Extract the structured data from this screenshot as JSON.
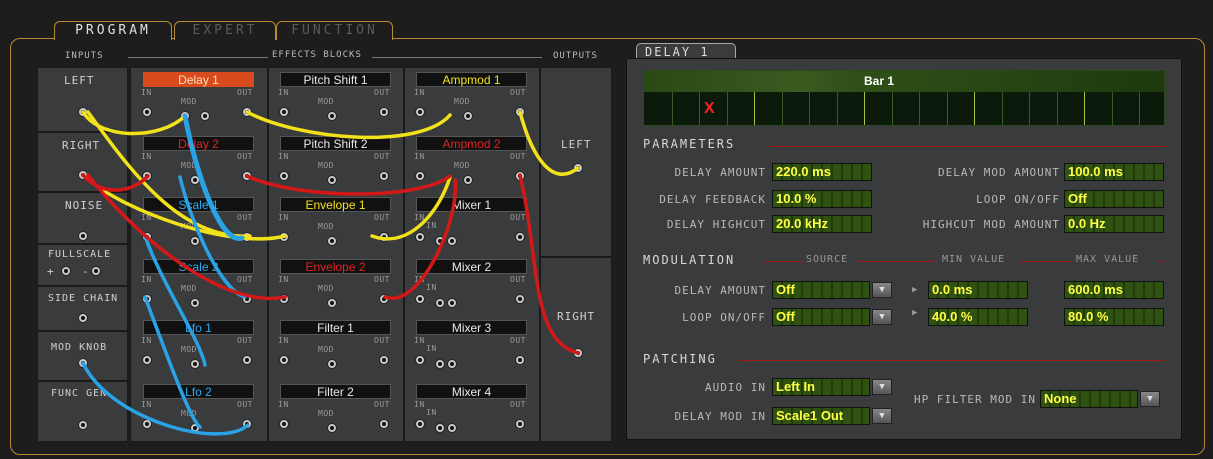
{
  "tabs": {
    "program": "PROGRAM",
    "expert": "EXPERT",
    "function": "FUNCTION"
  },
  "headers": {
    "inputs": "INPUTS",
    "effects": "EFFECTS BLOCKS",
    "outputs": "OUTPUTS"
  },
  "inputs": {
    "left": "LEFT",
    "right": "RIGHT",
    "noise": "NOISE",
    "fullscale": "FULLSCALE",
    "plus": "+",
    "minus": "-",
    "side_chain": "SIDE CHAIN",
    "mod_knob": "MOD KNOB",
    "func_gen": "FUNC GEN"
  },
  "outputs": {
    "left": "LEFT",
    "right": "RIGHT"
  },
  "jack_labels": {
    "in": "IN",
    "out": "OUT",
    "mod": "MOD"
  },
  "blocks": {
    "delay1": "Delay 1",
    "delay2": "Delay 2",
    "scale1": "Scale 1",
    "scale2": "Scale 2",
    "lfo1": "Lfo 1",
    "lfo2": "Lfo 2",
    "pitch1": "Pitch Shift 1",
    "pitch2": "Pitch Shift 2",
    "env1": "Envelope 1",
    "env2": "Envelope 2",
    "filter1": "Filter 1",
    "filter2": "Filter 2",
    "amp1": "Ampmod 1",
    "amp2": "Ampmod 2",
    "mixer1": "Mixer 1",
    "mixer2": "Mixer 2",
    "mixer3": "Mixer 3",
    "mixer4": "Mixer 4"
  },
  "right_panel": {
    "tab": "DELAY 1",
    "bar_label": "Bar 1",
    "marker": "X",
    "parameters": "PARAMETERS",
    "delay_amount_label": "DELAY AMOUNT",
    "delay_amount": "220.0 ms",
    "delay_feedback_label": "DELAY FEEDBACK",
    "delay_feedback": "10.0 %",
    "delay_highcut_label": "DELAY HIGHCUT",
    "delay_highcut": "20.0 kHz",
    "delay_mod_amount_label": "DELAY MOD AMOUNT",
    "delay_mod_amount": "100.0 ms",
    "loop_onoff_label": "LOOP ON/OFF",
    "loop_onoff": "Off",
    "highcut_mod_label": "HIGHCUT MOD AMOUNT",
    "highcut_mod": "0.0 Hz",
    "modulation": "MODULATION",
    "source": "SOURCE",
    "min_value": "MIN VALUE",
    "max_value": "MAX VALUE",
    "mod_delay_label": "DELAY AMOUNT",
    "mod_delay_source": "Off",
    "mod_delay_min": "0.0 ms",
    "mod_delay_max": "600.0 ms",
    "mod_loop_label": "LOOP ON/OFF",
    "mod_loop_source": "Off",
    "mod_loop_min": "40.0 %",
    "mod_loop_max": "80.0 %",
    "patching": "PATCHING",
    "audio_in_label": "AUDIO IN",
    "audio_in": "Left In",
    "delay_mod_in_label": "DELAY MOD IN",
    "delay_mod_in": "Scale1 Out",
    "hp_filter_label": "HP FILTER MOD IN",
    "hp_filter": "None"
  },
  "colors": {
    "yellow": "#f2e21a",
    "blue": "#29a3e6",
    "red": "#d41818",
    "active_block": "#d94a1c"
  }
}
